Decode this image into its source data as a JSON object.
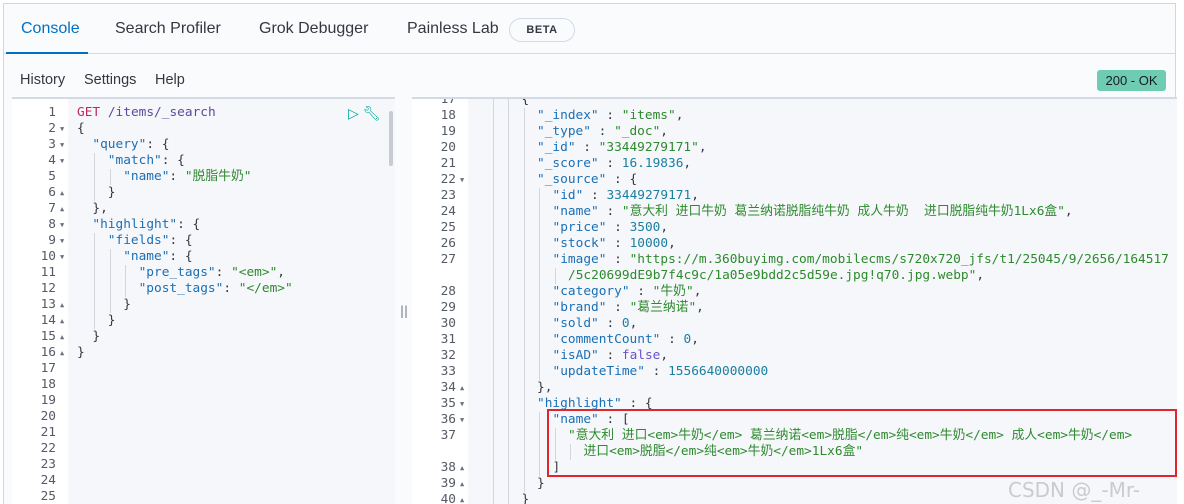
{
  "tabs": [
    {
      "label": "Console",
      "active": true
    },
    {
      "label": "Search Profiler"
    },
    {
      "label": "Grok Debugger"
    },
    {
      "label": "Painless Lab",
      "badge": "BETA"
    }
  ],
  "menu": [
    "History",
    "Settings",
    "Help"
  ],
  "status": {
    "label": "200 - OK",
    "color": "#6dccb1"
  },
  "request_lines": [
    {
      "n": "1",
      "t": [
        [
          "m",
          "GET"
        ],
        [
          "u",
          " /items/_search"
        ]
      ]
    },
    {
      "n": "2",
      "f": "d",
      "t": [
        [
          "p",
          "{"
        ]
      ]
    },
    {
      "n": "3",
      "f": "d",
      "i": 1,
      "t": [
        [
          "k",
          "\"query\""
        ],
        [
          "p",
          ": {"
        ]
      ]
    },
    {
      "n": "4",
      "f": "d",
      "i": 2,
      "t": [
        [
          "k",
          "\"match\""
        ],
        [
          "p",
          ": {"
        ]
      ]
    },
    {
      "n": "5",
      "i": 3,
      "t": [
        [
          "k",
          "\"name\""
        ],
        [
          "p",
          ": "
        ],
        [
          "s",
          "\"脱脂牛奶\""
        ]
      ]
    },
    {
      "n": "6",
      "f": "u",
      "i": 2,
      "t": [
        [
          "p",
          "}"
        ]
      ]
    },
    {
      "n": "7",
      "f": "u",
      "i": 1,
      "t": [
        [
          "p",
          "},"
        ]
      ]
    },
    {
      "n": "8",
      "f": "d",
      "i": 1,
      "t": [
        [
          "k",
          "\"highlight\""
        ],
        [
          "p",
          ": {"
        ]
      ]
    },
    {
      "n": "9",
      "f": "d",
      "i": 2,
      "t": [
        [
          "k",
          "\"fields\""
        ],
        [
          "p",
          ": {"
        ]
      ]
    },
    {
      "n": "10",
      "f": "d",
      "i": 3,
      "t": [
        [
          "k",
          "\"name\""
        ],
        [
          "p",
          ": {"
        ]
      ]
    },
    {
      "n": "11",
      "i": 4,
      "t": [
        [
          "k",
          "\"pre_tags\""
        ],
        [
          "p",
          ": "
        ],
        [
          "s",
          "\"<em>\""
        ],
        [
          "p",
          ","
        ]
      ]
    },
    {
      "n": "12",
      "i": 4,
      "t": [
        [
          "k",
          "\"post_tags\""
        ],
        [
          "p",
          ": "
        ],
        [
          "s",
          "\"</em>\""
        ]
      ]
    },
    {
      "n": "13",
      "f": "u",
      "i": 3,
      "t": [
        [
          "p",
          "}"
        ]
      ]
    },
    {
      "n": "14",
      "f": "u",
      "i": 2,
      "t": [
        [
          "p",
          "}"
        ]
      ]
    },
    {
      "n": "15",
      "f": "u",
      "i": 1,
      "t": [
        [
          "p",
          "}"
        ]
      ]
    },
    {
      "n": "16",
      "f": "u",
      "t": [
        [
          "p",
          "}"
        ]
      ]
    },
    {
      "n": "17",
      "t": []
    },
    {
      "n": "18",
      "t": []
    },
    {
      "n": "19",
      "t": []
    },
    {
      "n": "20",
      "t": []
    },
    {
      "n": "21",
      "t": []
    },
    {
      "n": "22",
      "t": []
    },
    {
      "n": "23",
      "t": []
    },
    {
      "n": "24",
      "t": []
    },
    {
      "n": "25",
      "t": []
    }
  ],
  "response_lines": [
    {
      "n": "17",
      "i": 3,
      "t": [
        [
          "p",
          "{"
        ]
      ]
    },
    {
      "n": "18",
      "i": 4,
      "t": [
        [
          "k",
          "\"_index\""
        ],
        [
          "p",
          " : "
        ],
        [
          "s",
          "\"items\""
        ],
        [
          "p",
          ","
        ]
      ]
    },
    {
      "n": "19",
      "i": 4,
      "t": [
        [
          "k",
          "\"_type\""
        ],
        [
          "p",
          " : "
        ],
        [
          "s",
          "\"_doc\""
        ],
        [
          "p",
          ","
        ]
      ]
    },
    {
      "n": "20",
      "i": 4,
      "t": [
        [
          "k",
          "\"_id\""
        ],
        [
          "p",
          " : "
        ],
        [
          "s",
          "\"33449279171\""
        ],
        [
          "p",
          ","
        ]
      ]
    },
    {
      "n": "21",
      "i": 4,
      "t": [
        [
          "k",
          "\"_score\""
        ],
        [
          "p",
          " : "
        ],
        [
          "n",
          "16.19836"
        ],
        [
          "p",
          ","
        ]
      ]
    },
    {
      "n": "22",
      "f": "d",
      "i": 4,
      "t": [
        [
          "k",
          "\"_source\""
        ],
        [
          "p",
          " : {"
        ]
      ]
    },
    {
      "n": "23",
      "i": 5,
      "t": [
        [
          "k",
          "\"id\""
        ],
        [
          "p",
          " : "
        ],
        [
          "n",
          "33449279171"
        ],
        [
          "p",
          ","
        ]
      ]
    },
    {
      "n": "24",
      "i": 5,
      "t": [
        [
          "k",
          "\"name\""
        ],
        [
          "p",
          " : "
        ],
        [
          "s",
          "\"意大利 进口牛奶 葛兰纳诺脱脂纯牛奶 成人牛奶  进口脱脂纯牛奶1Lx6盒\""
        ],
        [
          "p",
          ","
        ]
      ]
    },
    {
      "n": "25",
      "i": 5,
      "t": [
        [
          "k",
          "\"price\""
        ],
        [
          "p",
          " : "
        ],
        [
          "n",
          "3500"
        ],
        [
          "p",
          ","
        ]
      ]
    },
    {
      "n": "26",
      "i": 5,
      "t": [
        [
          "k",
          "\"stock\""
        ],
        [
          "p",
          " : "
        ],
        [
          "n",
          "10000"
        ],
        [
          "p",
          ","
        ]
      ]
    },
    {
      "n": "27",
      "i": 5,
      "t": [
        [
          "k",
          "\"image\""
        ],
        [
          "p",
          " : "
        ],
        [
          "s",
          "\"https://m.360buyimg.com/mobilecms/s720x720_jfs/t1/25045/9/2656/164517"
        ]
      ]
    },
    {
      "n": "",
      "i": 6,
      "t": [
        [
          "s",
          "/5c20699dE9b7f4c9c/1a05e9bdd2c5d59e.jpg!q70.jpg.webp\""
        ],
        [
          "p",
          ","
        ]
      ]
    },
    {
      "n": "28",
      "i": 5,
      "t": [
        [
          "k",
          "\"category\""
        ],
        [
          "p",
          " : "
        ],
        [
          "s",
          "\"牛奶\""
        ],
        [
          "p",
          ","
        ]
      ]
    },
    {
      "n": "29",
      "i": 5,
      "t": [
        [
          "k",
          "\"brand\""
        ],
        [
          "p",
          " : "
        ],
        [
          "s",
          "\"葛兰纳诺\""
        ],
        [
          "p",
          ","
        ]
      ]
    },
    {
      "n": "30",
      "i": 5,
      "t": [
        [
          "k",
          "\"sold\""
        ],
        [
          "p",
          " : "
        ],
        [
          "n",
          "0"
        ],
        [
          "p",
          ","
        ]
      ]
    },
    {
      "n": "31",
      "i": 5,
      "t": [
        [
          "k",
          "\"commentCount\""
        ],
        [
          "p",
          " : "
        ],
        [
          "n",
          "0"
        ],
        [
          "p",
          ","
        ]
      ]
    },
    {
      "n": "32",
      "i": 5,
      "t": [
        [
          "k",
          "\"isAD\""
        ],
        [
          "p",
          " : "
        ],
        [
          "b",
          "false"
        ],
        [
          "p",
          ","
        ]
      ]
    },
    {
      "n": "33",
      "i": 5,
      "t": [
        [
          "k",
          "\"updateTime\""
        ],
        [
          "p",
          " : "
        ],
        [
          "n",
          "1556640000000"
        ]
      ]
    },
    {
      "n": "34",
      "f": "u",
      "i": 4,
      "t": [
        [
          "p",
          "},"
        ]
      ]
    },
    {
      "n": "35",
      "f": "d",
      "i": 4,
      "t": [
        [
          "k",
          "\"highlight\""
        ],
        [
          "p",
          " : {"
        ]
      ]
    },
    {
      "n": "36",
      "f": "d",
      "i": 5,
      "t": [
        [
          "k",
          "\"name\""
        ],
        [
          "p",
          " : ["
        ]
      ]
    },
    {
      "n": "37",
      "i": 6,
      "t": [
        [
          "s",
          "\"意大利 进口<em>牛奶</em> 葛兰纳诺<em>脱脂</em>纯<em>牛奶</em> 成人<em>牛奶</em>"
        ]
      ]
    },
    {
      "n": "",
      "i": 7,
      "t": [
        [
          "s",
          "进口<em>脱脂</em>纯<em>牛奶</em>1Lx6盒\""
        ]
      ]
    },
    {
      "n": "38",
      "f": "u",
      "i": 5,
      "t": [
        [
          "p",
          "]"
        ]
      ]
    },
    {
      "n": "39",
      "f": "u",
      "i": 4,
      "t": [
        [
          "p",
          "}"
        ]
      ]
    },
    {
      "n": "40",
      "f": "u",
      "i": 3,
      "t": [
        [
          "p",
          "}"
        ]
      ]
    }
  ],
  "watermark": "CSDN @_-Mr-sun"
}
